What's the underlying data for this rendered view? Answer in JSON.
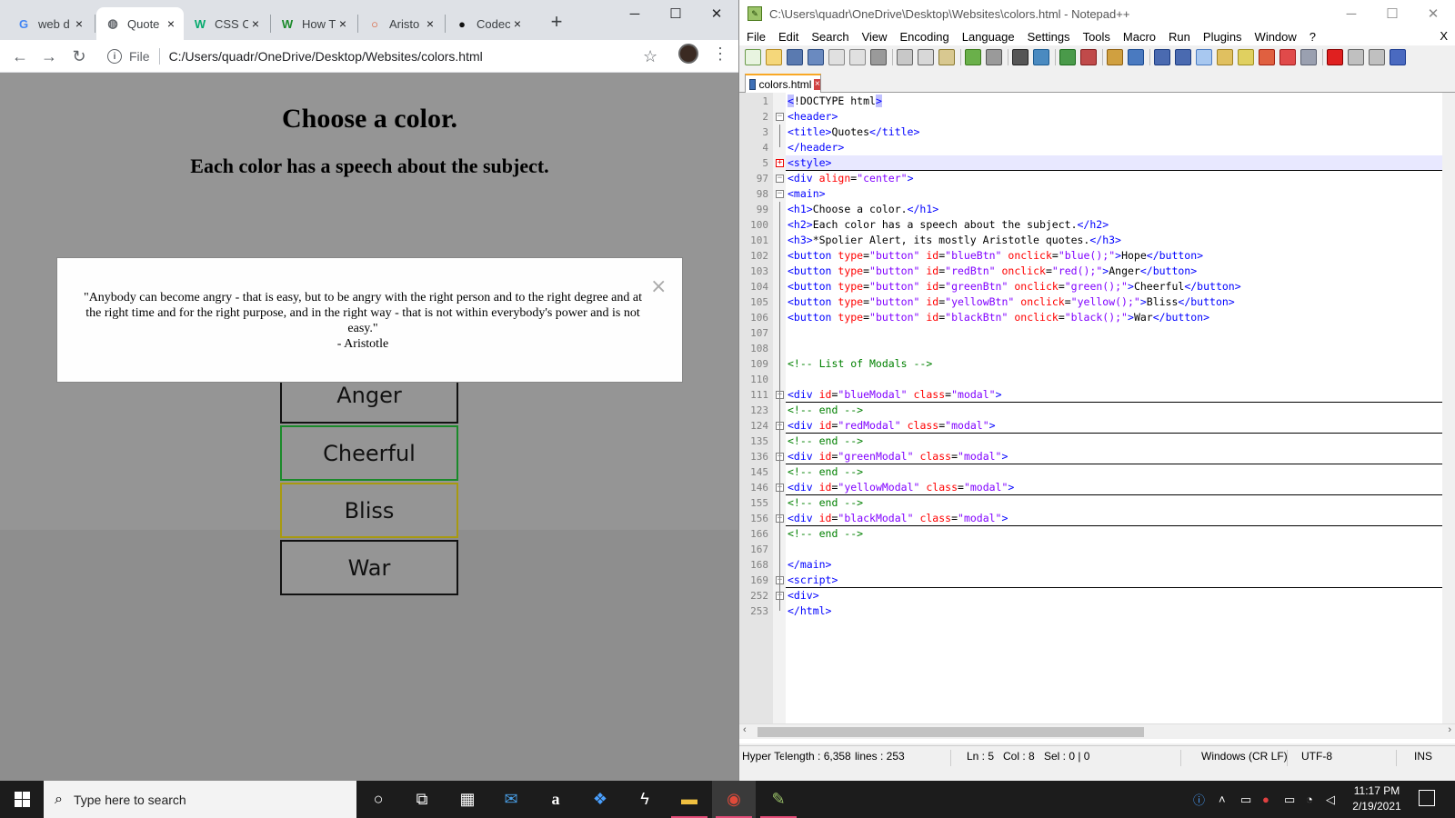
{
  "chrome": {
    "tabs": [
      {
        "title": "web d",
        "icon": "google-icon"
      },
      {
        "title": "Quote",
        "icon": "globe-icon"
      },
      {
        "title": "CSS C",
        "icon": "w3-icon"
      },
      {
        "title": "How T",
        "icon": "wikihow-icon"
      },
      {
        "title": "Aristo",
        "icon": "quotes-site-icon"
      },
      {
        "title": "Codec",
        "icon": "github-icon"
      }
    ],
    "address": {
      "scheme_label": "File",
      "url": "C:/Users/quadr/OneDrive/Desktop/Websites/colors.html"
    },
    "page": {
      "heading": "Choose a color.",
      "subheading": "Each color has a speech about the subject.",
      "buttons": [
        "Anger",
        "Cheerful",
        "Bliss",
        "War"
      ],
      "modal": {
        "quote": "\"Anybody can become angry - that is easy, but to be angry with the right person and to the right degree and at the right time and for the right purpose, and in the right way - that is not within everybody's power and is not easy.\"",
        "author": "- Aristotle",
        "close": "×"
      }
    }
  },
  "notepad": {
    "title": "C:\\Users\\quadr\\OneDrive\\Desktop\\Websites\\colors.html - Notepad++",
    "menu": [
      "File",
      "Edit",
      "Search",
      "View",
      "Encoding",
      "Language",
      "Settings",
      "Tools",
      "Macro",
      "Run",
      "Plugins",
      "Window",
      "?"
    ],
    "menu_close": "X",
    "file_tab": "colors.html",
    "line_numbers": [
      "1",
      "2",
      "3",
      "4",
      "5",
      "97",
      "98",
      "99",
      "100",
      "101",
      "102",
      "103",
      "104",
      "105",
      "106",
      "107",
      "108",
      "109",
      "110",
      "111",
      "123",
      "124",
      "135",
      "136",
      "145",
      "146",
      "155",
      "156",
      "166",
      "167",
      "168",
      "169",
      "252",
      "253"
    ],
    "status": {
      "type": "Hyper Te",
      "length": "length : 6,358",
      "lines": "lines : 253",
      "ln": "Ln : 5",
      "col": "Col : 8",
      "sel": "Sel : 0 | 0",
      "eol": "Windows (CR LF)",
      "encoding": "UTF-8",
      "mode": "INS"
    }
  },
  "taskbar": {
    "search_placeholder": "Type here to search",
    "time": "11:17 PM",
    "date": "2/19/2021"
  },
  "colors": {
    "tag": "#0000ff",
    "attr": "#ff0000",
    "value": "#8000ff",
    "comment": "#008000",
    "modal_bg": "#fefefe",
    "page_bg": "#959595",
    "cheerful_border": "#1a8a2a",
    "bliss_border": "#a89a10"
  }
}
